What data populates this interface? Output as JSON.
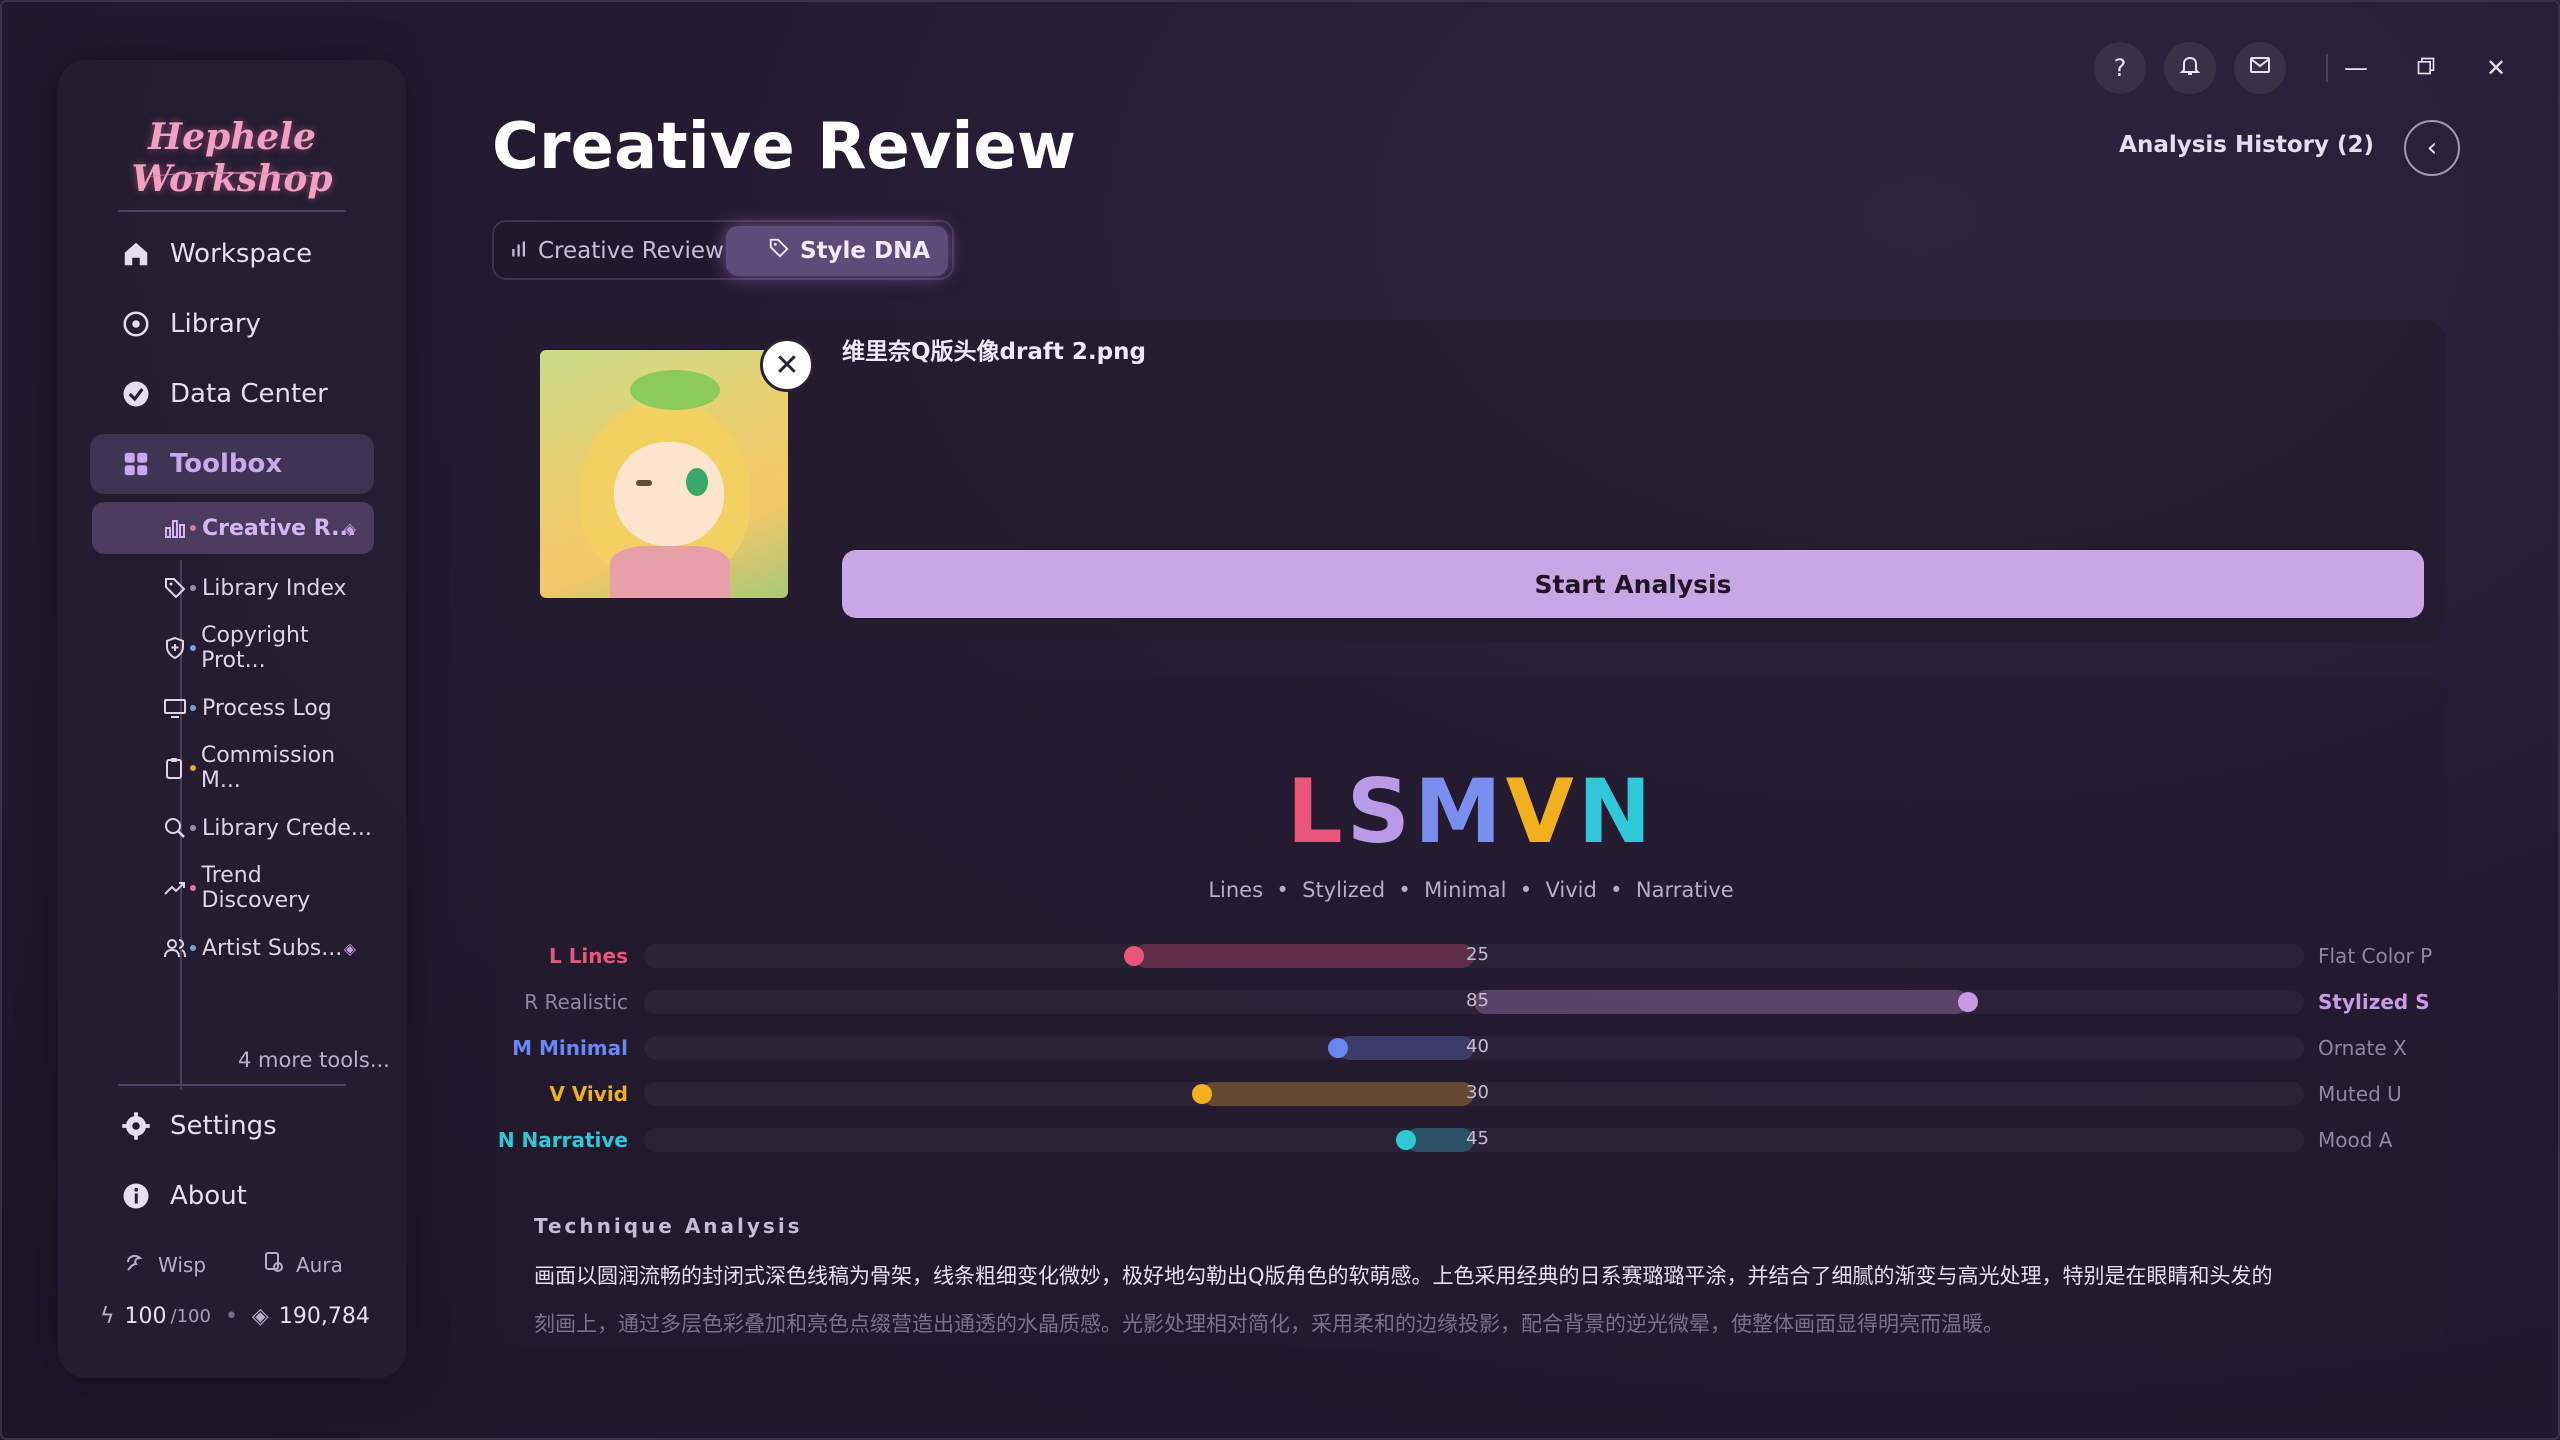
{
  "app": {
    "logo_text": "Hephele Workshop"
  },
  "sidebar": {
    "nav": [
      {
        "label": "Workspace",
        "icon": "home-icon"
      },
      {
        "label": "Library",
        "icon": "compass-icon"
      },
      {
        "label": "Data Center",
        "icon": "gauge-icon"
      },
      {
        "label": "Toolbox",
        "icon": "grid-icon"
      }
    ],
    "tools": [
      {
        "label": "Creative R...",
        "icon": "bar-chart-icon",
        "dot": "#e07aa2",
        "premium": true
      },
      {
        "label": "Library Index",
        "icon": "tag-icon",
        "dot": "#9a8fb0",
        "premium": false
      },
      {
        "label": "Copyright Prot...",
        "icon": "shield-icon",
        "dot": "#7aa0e0",
        "premium": false
      },
      {
        "label": "Process Log",
        "icon": "monitor-icon",
        "dot": "#7aa0e0",
        "premium": false
      },
      {
        "label": "Commission M...",
        "icon": "clipboard-icon",
        "dot": "#e8a840",
        "premium": false
      },
      {
        "label": "Library Crede...",
        "icon": "search-icon",
        "dot": "#9a8fb0",
        "premium": false
      },
      {
        "label": "Trend Discovery",
        "icon": "trend-icon",
        "dot": "#e07aa2",
        "premium": false
      },
      {
        "label": "Artist Subs...",
        "icon": "users-icon",
        "dot": "#7aa0e0",
        "premium": true
      }
    ],
    "more_tools": "4 more tools...",
    "footer_nav": [
      {
        "label": "Settings",
        "icon": "gear-icon"
      },
      {
        "label": "About",
        "icon": "info-icon"
      }
    ],
    "wisp_label": "Wisp",
    "aura_label": "Aura",
    "energy_value": "100",
    "energy_max": "/100",
    "gems_value": "190,784"
  },
  "header": {
    "title": "Creative Review",
    "tabs": [
      {
        "label": "Creative Review",
        "icon": "bar-chart-icon",
        "active": false
      },
      {
        "label": "Style DNA",
        "icon": "tag-icon",
        "active": true
      }
    ],
    "history_label": "Analysis History (2)"
  },
  "upload": {
    "file_name": "维里奈Q版头像draft 2.png",
    "start_label": "Start Analysis"
  },
  "dna": {
    "code_letters": [
      {
        "letter": "L",
        "color": "#e8567a"
      },
      {
        "letter": "S",
        "color": "#b89ae6"
      },
      {
        "letter": "M",
        "color": "#7a8ef0"
      },
      {
        "letter": "V",
        "color": "#f0b020"
      },
      {
        "letter": "N",
        "color": "#30c8d8"
      }
    ],
    "words": "Lines  •  Stylized  •  Minimal  •  Vivid  •  Narrative",
    "dimensions": [
      {
        "left": "L Lines",
        "right": "Flat Color P",
        "value": 25,
        "side": "left",
        "color": "#e8567a",
        "left_active": true,
        "right_active": false
      },
      {
        "left": "R Realistic",
        "right": "Stylized S",
        "value": 85,
        "side": "right",
        "color": "#c89ae6",
        "left_active": false,
        "right_active": true
      },
      {
        "left": "M Minimal",
        "right": "Ornate X",
        "value": 40,
        "side": "left",
        "color": "#6a86f0",
        "left_active": true,
        "right_active": false
      },
      {
        "left": "V Vivid",
        "right": "Muted U",
        "value": 30,
        "side": "left",
        "color": "#f0b020",
        "left_active": true,
        "right_active": false
      },
      {
        "left": "N Narrative",
        "right": "Mood A",
        "value": 45,
        "side": "left",
        "color": "#30c8d8",
        "left_active": true,
        "right_active": false
      }
    ]
  },
  "technique": {
    "title": "Technique Analysis",
    "text": "画面以圆润流畅的封闭式深色线稿为骨架，线条粗细变化微妙，极好地勾勒出Q版角色的软萌感。上色采用经典的日系赛璐璐平涂，并结合了细腻的渐变与高光处理，特别是在眼睛和头发的",
    "text_faded": "刻画上，通过多层色彩叠加和亮色点缀营造出通透的水晶质感。光影处理相对简化，采用柔和的边缘投影，配合背景的逆光微晕，使整体画面显得明亮而温暖。"
  }
}
